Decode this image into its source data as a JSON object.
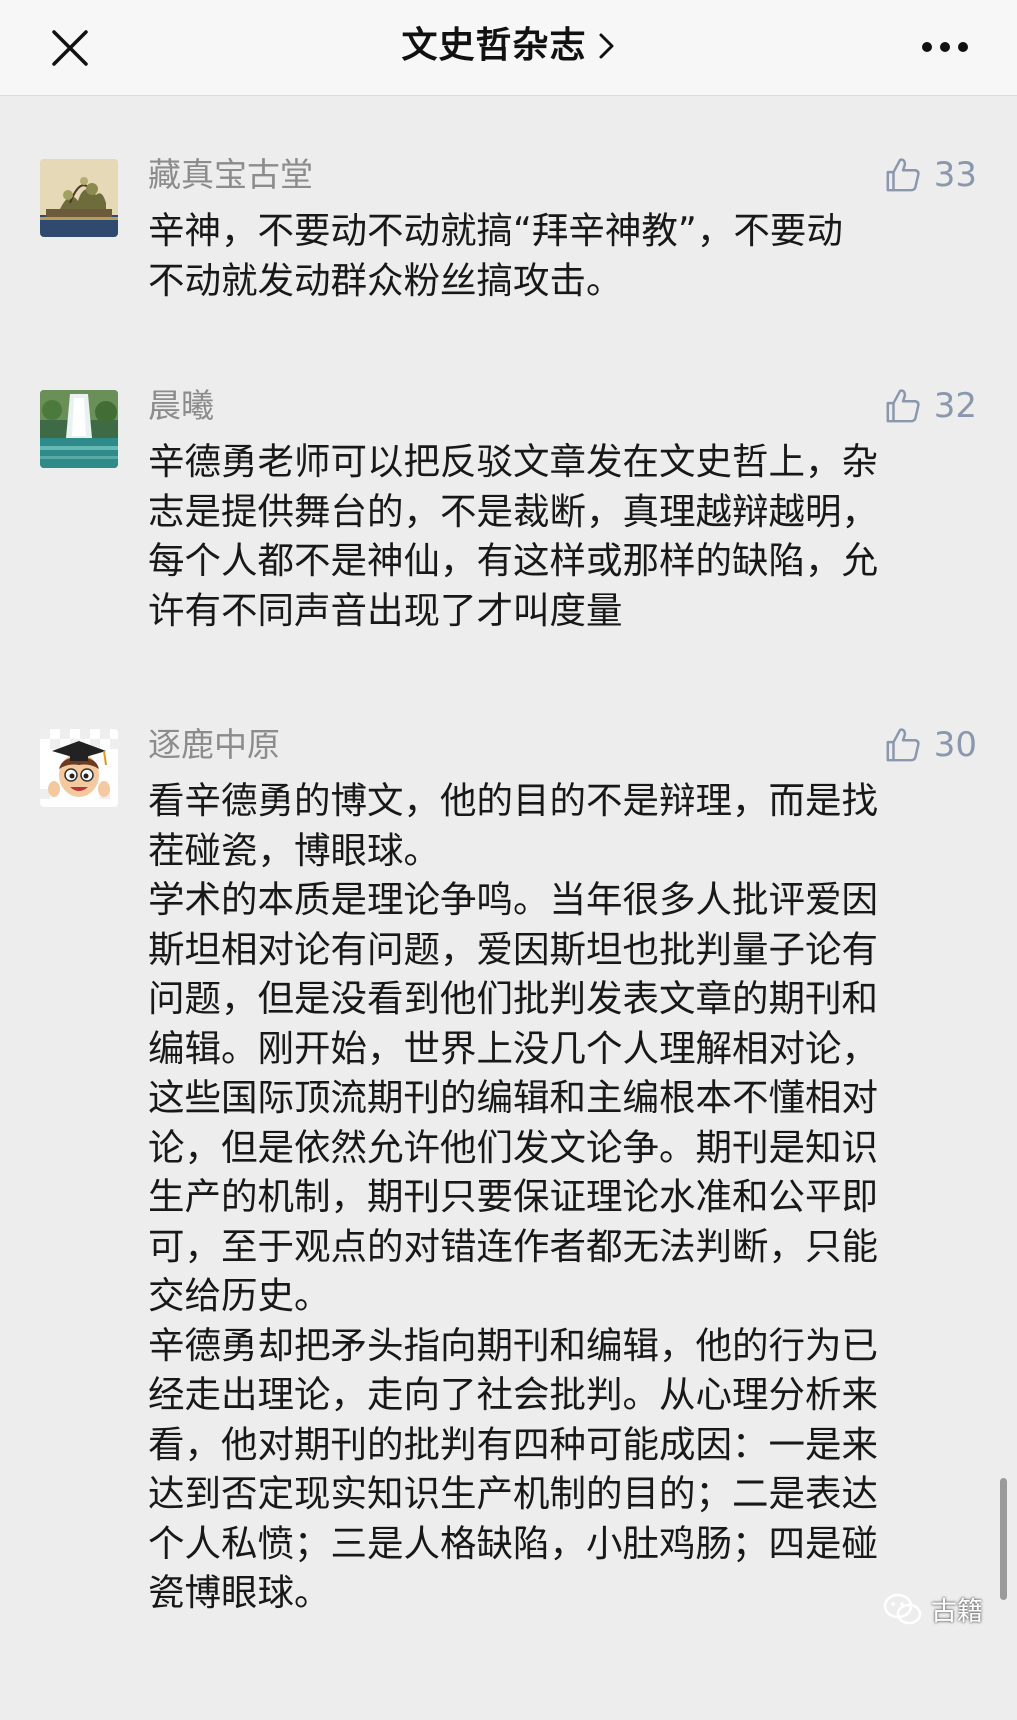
{
  "header": {
    "title": "文史哲杂志",
    "close_icon": "close-icon",
    "chevron_icon": "chevron-right-icon",
    "more_icon": "more-dots-icon"
  },
  "comments": [
    {
      "name": "藏真宝古堂",
      "likes": "33",
      "text": "辛神，不要动不动就搞“拜辛神教”，不要动\n不动就发动群众粉丝搞攻击。"
    },
    {
      "name": "晨曦",
      "likes": "32",
      "text": "辛德勇老师可以把反驳文章发在文史哲上，杂\n志是提供舞台的，不是裁断，真理越辩越明，\n每个人都不是神仙，有这样或那样的缺陷，允\n许有不同声音出现了才叫度量"
    },
    {
      "name": "逐鹿中原",
      "likes": "30",
      "text": "看辛德勇的博文，他的目的不是辩理，而是找\n茬碰瓷，博眼球。\n学术的本质是理论争鸣。当年很多人批评爱因\n斯坦相对论有问题，爱因斯坦也批判量子论有\n问题，但是没看到他们批判发表文章的期刊和\n编辑。刚开始，世界上没几个人理解相对论，\n这些国际顶流期刊的编辑和主编根本不懂相对\n论，但是依然允许他们发文论争。期刊是知识\n生产的机制，期刊只要保证理论水准和公平即\n可，至于观点的对错连作者都无法判断，只能\n交给历史。\n辛德勇却把矛头指向期刊和编辑，他的行为已\n经走出理论，走向了社会批判。从心理分析来\n看，他对期刊的批判有四种可能成因：一是来\n达到否定现实知识生产机制的目的；二是表达\n个人私愤；三是人格缺陷，小肚鸡肠；四是碰\n瓷博眼球。"
    }
  ],
  "watermark": {
    "text": "古籍"
  },
  "colors": {
    "page_bg": "#ededed",
    "header_bg": "#f7f7f7",
    "nickname": "#8c8c8c",
    "like": "#8a97ad",
    "text": "#181818"
  }
}
